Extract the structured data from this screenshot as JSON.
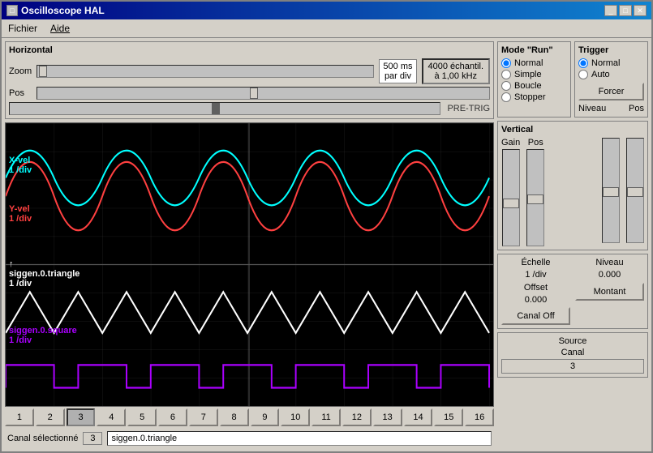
{
  "window": {
    "title": "Oscilloscope HAL",
    "icon": "□"
  },
  "titleButtons": [
    "_",
    "□",
    "✕"
  ],
  "menu": {
    "items": [
      "Fichier",
      "Aide"
    ]
  },
  "horizontal": {
    "label": "Horizontal",
    "zoom_label": "Zoom",
    "pos_label": "Pos",
    "time_value": "500 ms",
    "time_unit": "par div",
    "samples_value": "4000 échantil.",
    "samples_unit": "à 1,00 kHz",
    "pretrig_label": "PRE-TRIG"
  },
  "mode_run": {
    "title": "Mode \"Run\"",
    "options": [
      "Normal",
      "Simple",
      "Boucle",
      "Stopper"
    ],
    "selected": "Normal"
  },
  "trigger": {
    "title": "Trigger",
    "options": [
      "Normal",
      "Auto"
    ],
    "selected": "Normal",
    "forcer_label": "Forcer",
    "niveau_label": "Niveau",
    "pos_label": "Pos"
  },
  "vertical": {
    "title": "Vertical",
    "gain_label": "Gain",
    "pos_label": "Pos"
  },
  "echelle": {
    "label": "Échelle",
    "value": "1 /div",
    "offset_label": "Offset",
    "offset_value": "0.000",
    "canal_off_label": "Canal Off"
  },
  "niveau": {
    "label": "Niveau",
    "value": "0.000",
    "montant_label": "Montant"
  },
  "source_canal": {
    "label": "Source",
    "canal_label": "Canal",
    "canal_value": "3"
  },
  "channels": {
    "buttons": [
      "1",
      "2",
      "3",
      "4",
      "5",
      "6",
      "7",
      "8",
      "9",
      "10",
      "11",
      "12",
      "13",
      "14",
      "15",
      "16"
    ],
    "active": "3",
    "canal_selectionne": "Canal sélectionné",
    "canal_num": "3",
    "canal_signal": "siggen.0.triangle"
  },
  "channel_labels": [
    {
      "name": "X-vel",
      "sub": "1 /div",
      "color": "#00ffff"
    },
    {
      "name": "Y-vel",
      "sub": "1 /div",
      "color": "#ff4040"
    },
    {
      "name": "siggen.0.triangle",
      "sub": "1 /div",
      "color": "#ffffff"
    },
    {
      "name": "siggen.0.square",
      "sub": "1 /div",
      "color": "#aa00ff"
    }
  ]
}
